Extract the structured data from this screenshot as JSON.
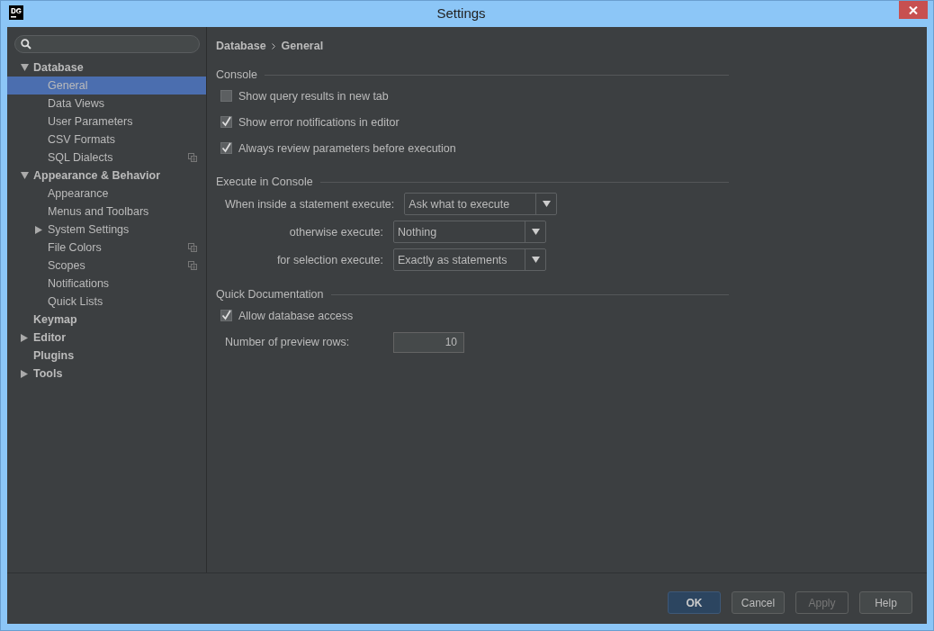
{
  "window": {
    "title": "Settings"
  },
  "sidebar": {
    "items": [
      {
        "label": "Database",
        "expanded": true,
        "selected": false,
        "copy_icon": false,
        "children": [
          {
            "label": "General",
            "selected": true,
            "copy_icon": false
          },
          {
            "label": "Data Views",
            "selected": false,
            "copy_icon": false
          },
          {
            "label": "User Parameters",
            "selected": false,
            "copy_icon": false
          },
          {
            "label": "CSV Formats",
            "selected": false,
            "copy_icon": false
          },
          {
            "label": "SQL Dialects",
            "selected": false,
            "copy_icon": true
          }
        ]
      },
      {
        "label": "Appearance & Behavior",
        "expanded": true,
        "selected": false,
        "copy_icon": false,
        "children": [
          {
            "label": "Appearance",
            "selected": false,
            "copy_icon": false
          },
          {
            "label": "Menus and Toolbars",
            "selected": false,
            "copy_icon": false
          },
          {
            "label": "System Settings",
            "expanded": false,
            "selected": false,
            "copy_icon": false
          },
          {
            "label": "File Colors",
            "selected": false,
            "copy_icon": true
          },
          {
            "label": "Scopes",
            "selected": false,
            "copy_icon": true
          },
          {
            "label": "Notifications",
            "selected": false,
            "copy_icon": false
          },
          {
            "label": "Quick Lists",
            "selected": false,
            "copy_icon": false
          }
        ]
      },
      {
        "label": "Keymap",
        "selected": false,
        "copy_icon": false
      },
      {
        "label": "Editor",
        "expanded": false,
        "selected": false,
        "copy_icon": false
      },
      {
        "label": "Plugins",
        "selected": false,
        "copy_icon": false
      },
      {
        "label": "Tools",
        "expanded": false,
        "selected": false,
        "copy_icon": false
      }
    ]
  },
  "breadcrumb": [
    "Database",
    "General"
  ],
  "sections": [
    {
      "title": "Console",
      "rows": [
        {
          "kind": "checkbox",
          "label": "Show query results in new tab",
          "checked": false
        },
        {
          "kind": "checkbox",
          "label": "Show error notifications in editor",
          "checked": true
        },
        {
          "kind": "checkbox",
          "label": "Always review parameters before execution",
          "checked": true
        }
      ]
    },
    {
      "title": "Execute in Console",
      "rows": [
        {
          "kind": "combo",
          "label": "When inside a statement execute:",
          "value": "Ask what to execute"
        },
        {
          "kind": "combo",
          "label": "otherwise execute:",
          "value": "Nothing"
        },
        {
          "kind": "combo",
          "label": "for selection execute:",
          "value": "Exactly as statements"
        }
      ]
    },
    {
      "title": "Quick Documentation",
      "rows": [
        {
          "kind": "checkbox",
          "label": "Allow database access",
          "checked": true
        },
        {
          "kind": "number",
          "label": "Number of preview rows:",
          "value": "10"
        }
      ]
    }
  ],
  "buttons": [
    {
      "label": "OK",
      "default": true,
      "disabled": false
    },
    {
      "label": "Cancel",
      "default": false,
      "disabled": false
    },
    {
      "label": "Apply",
      "default": false,
      "disabled": true
    },
    {
      "label": "Help",
      "default": false,
      "disabled": false
    }
  ]
}
